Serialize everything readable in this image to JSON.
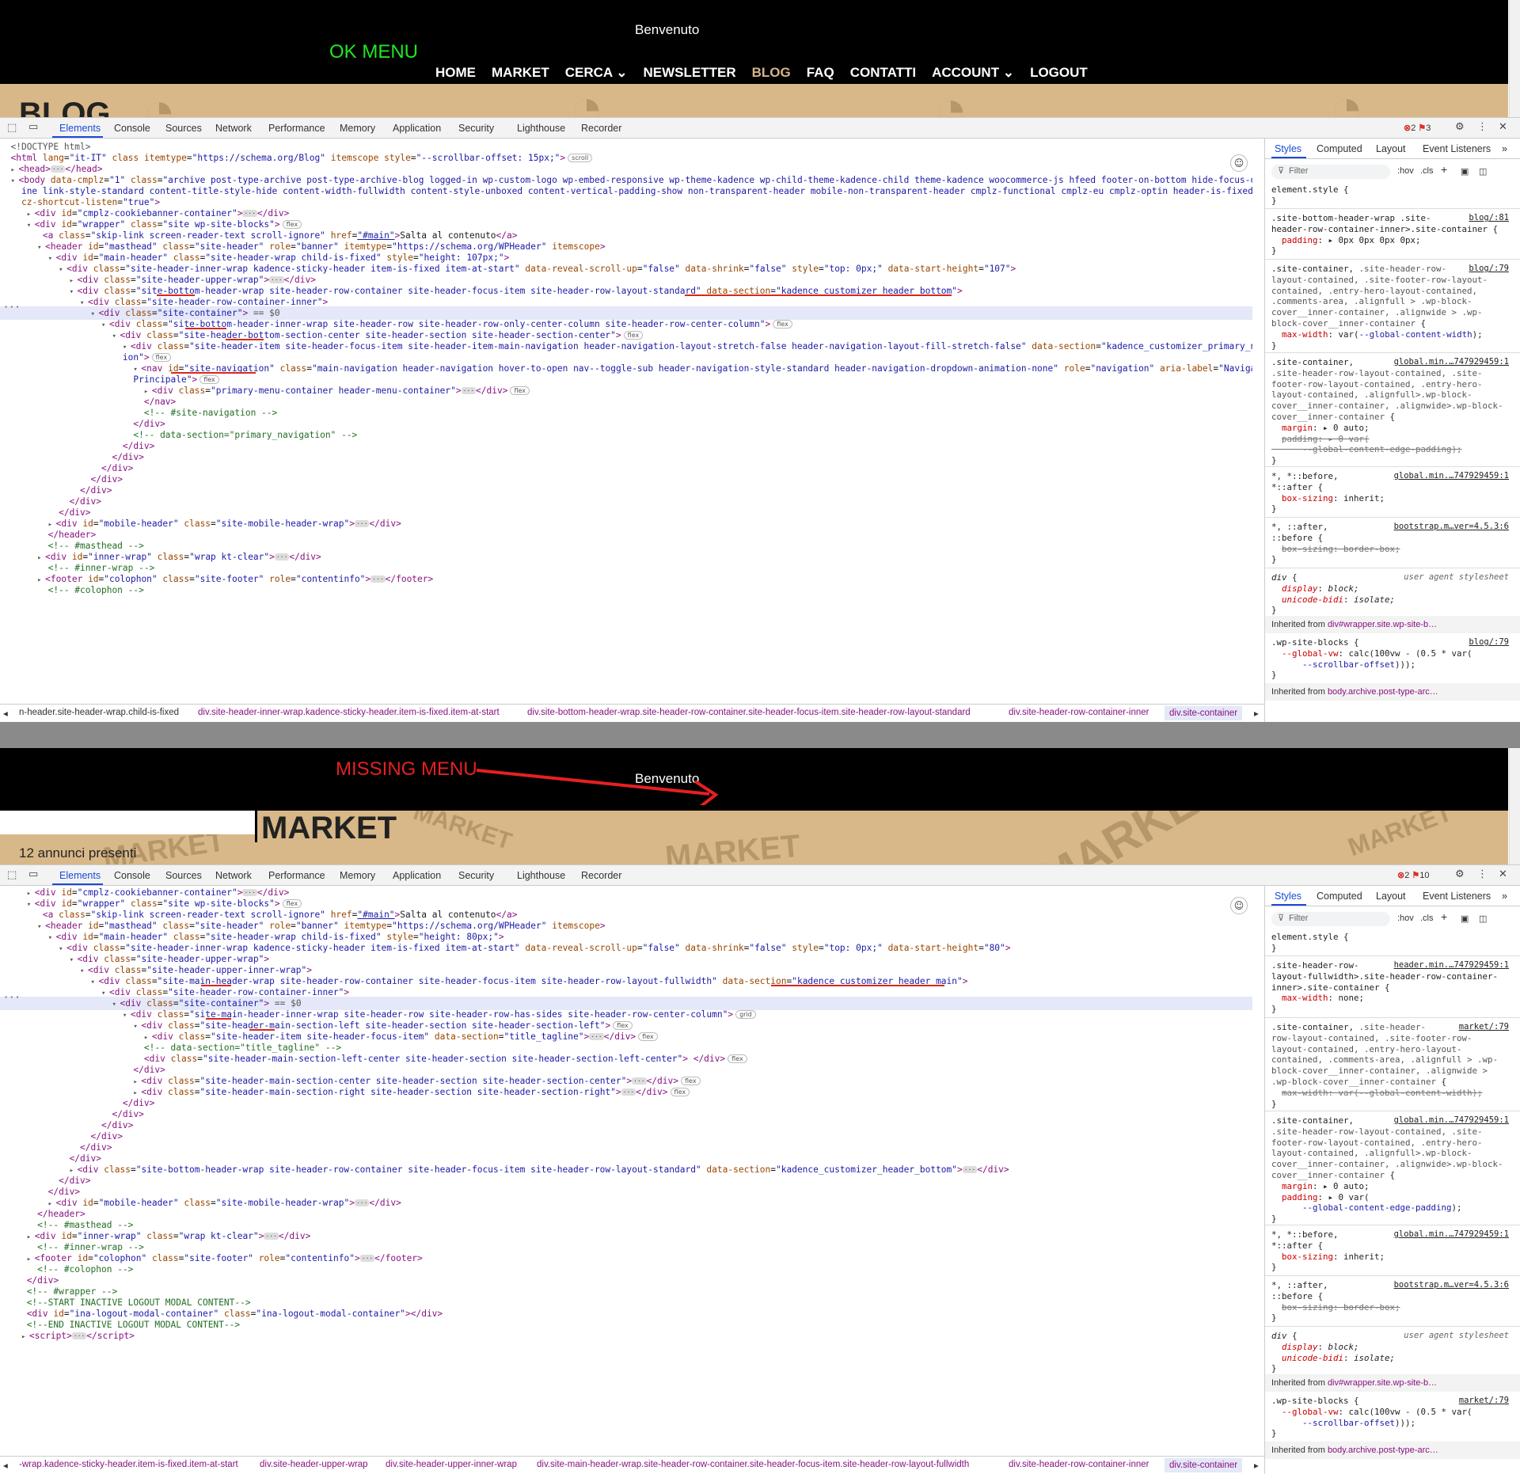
{
  "site1": {
    "welcome": "Benvenuto",
    "note": "OK MENU",
    "nav": [
      "HOME",
      "MARKET",
      "CERCA ⌄",
      "NEWSLETTER",
      "BLOG",
      "FAQ",
      "CONTATTI",
      "ACCOUNT ⌄",
      "LOGOUT"
    ],
    "page_heading": "BLOG"
  },
  "site2": {
    "welcome": "Benvenuto",
    "note": "MISSING MENU",
    "page_heading": "MARKET",
    "announcements": "12 annunci presenti",
    "deco_words": [
      "MARKET",
      "MARKET",
      "MARKET",
      "MARKET",
      "MARKET"
    ]
  },
  "devtools": {
    "tabs": [
      "Elements",
      "Console",
      "Sources",
      "Network",
      "Performance",
      "Memory",
      "Application",
      "Security",
      "Lighthouse",
      "Recorder"
    ],
    "errors1": "2",
    "warnings1": "3",
    "errors2": "2",
    "warnings2": "10",
    "style_tabs": [
      "Styles",
      "Computed",
      "Layout",
      "Event Listeners"
    ],
    "filter_placeholder": "Filter",
    "hov": ":hov",
    "cls": ".cls",
    "more": "»"
  },
  "crumbs1": [
    "n-header.site-header-wrap.child-is-fixed",
    "div.site-header-inner-wrap.kadence-sticky-header.item-is-fixed.item-at-start",
    "div.site-bottom-header-wrap.site-header-row-container.site-header-focus-item.site-header-row-layout-standard",
    "div.site-header-row-container-inner",
    "div.site-container"
  ],
  "crumbs2": [
    "-wrap.kadence-sticky-header.item-is-fixed.item-at-start",
    "div.site-header-upper-wrap",
    "div.site-header-upper-inner-wrap",
    "div.site-main-header-wrap.site-header-row-container.site-header-focus-item.site-header-row-layout-fullwidth",
    "div.site-header-row-container-inner",
    "div.site-container"
  ],
  "inherited1a": "Inherited from",
  "inherited1a_el": "div#wrapper.site.wp-site-b…",
  "inherited1b": "Inherited from",
  "inherited1b_el": "body.archive.post-type-arc…",
  "inherited2a": "Inherited from",
  "inherited2a_el": "div#wrapper.site.wp-site-b…",
  "inherited2b": "Inherited from",
  "inherited2b_el": "body.archive.post-type-arc…",
  "colors": {
    "ok": "#21e621",
    "missing": "#e62020",
    "active_nav": "#d4b48c",
    "banner": "#d8b888"
  },
  "icons": [
    "inspect-icon",
    "device-icon",
    "gear-icon",
    "kebab-icon",
    "close-icon",
    "accessibility-icon",
    "filter-icon",
    "plus-icon",
    "paint-icon",
    "sidebar-icon",
    "arrow-icon"
  ]
}
